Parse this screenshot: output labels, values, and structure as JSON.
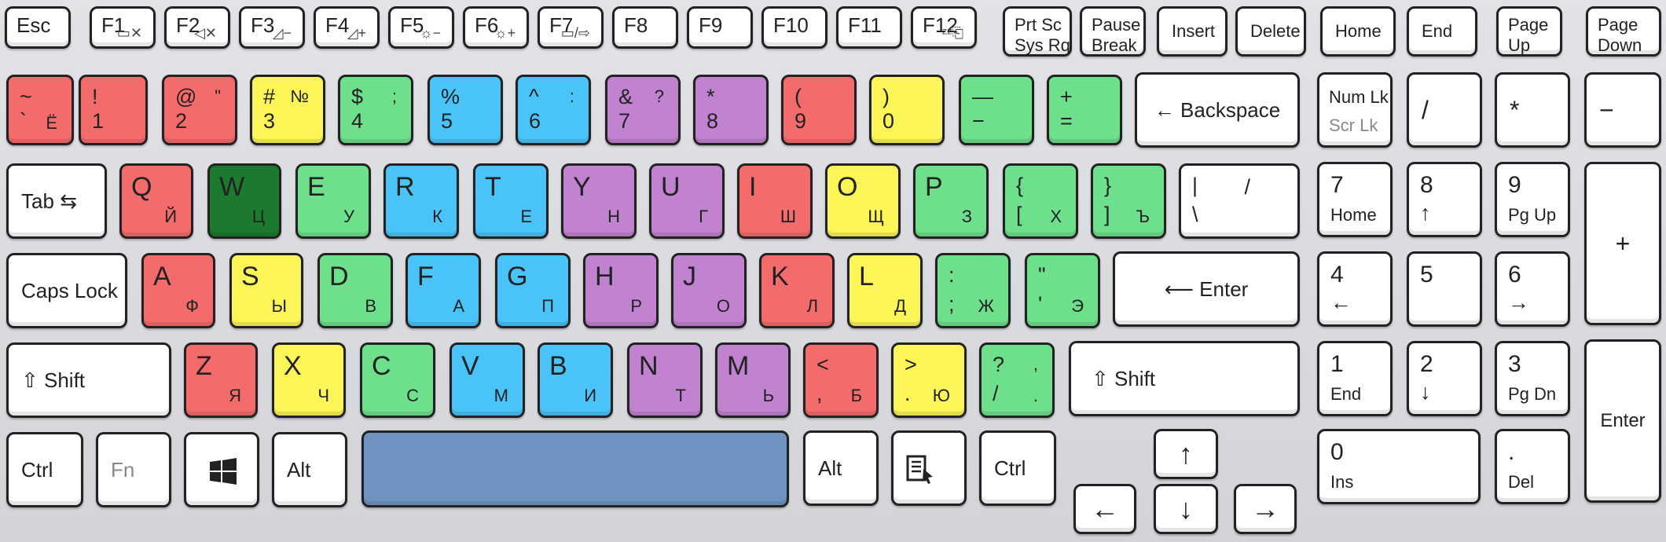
{
  "colors": {
    "red": "#f46b6b",
    "yellow": "#fbf558",
    "green": "#6ee08c",
    "blue": "#4ac3f8",
    "purple": "#c182d0",
    "dark_green": "#1b7a2e",
    "space": "#6f93c0",
    "key": "#ffffff",
    "frame": "#d9dade"
  },
  "function_row": {
    "esc": "Esc",
    "f1": "F1",
    "f2": "F2",
    "f3": "F3",
    "f4": "F4",
    "f5": "F5",
    "f6": "F6",
    "f7": "F7",
    "f8": "F8",
    "f9": "F9",
    "f10": "F10",
    "f11": "F11",
    "f12": "F12",
    "f3_icon": "◿−",
    "f4_icon": "◿+",
    "f5_icon": "☼−",
    "f6_icon": "☼+",
    "f2_icon": "🔇",
    "f7_icon": "▭/⇨",
    "prtsc_1": "Prt Sc",
    "prtsc_2": "Sys Rq",
    "pause_1": "Pause",
    "pause_2": "Break",
    "insert": "Insert",
    "delete": "Delete",
    "home": "Home",
    "end": "End",
    "pgup_1": "Page",
    "pgup_2": "Up",
    "pgdn_1": "Page",
    "pgdn_2": "Down"
  },
  "number_row": {
    "tilde": "~",
    "tilde_ru": "Ё",
    "tilde_b": "`",
    "k1_t": "!",
    "k1": "1",
    "k2_t": "@",
    "k2_tr": "\"",
    "k2": "2",
    "k3_t": "#",
    "k3_tr": "№",
    "k3": "3",
    "k4_t": "$",
    "k4_tr": ";",
    "k4": "4",
    "k5_t": "%",
    "k5": "5",
    "k6_t": "^",
    "k6_tr": ":",
    "k6": "6",
    "k7_t": "&",
    "k7_tr": "?",
    "k7": "7",
    "k8_t": "*",
    "k8": "8",
    "k9_t": "(",
    "k9": "9",
    "k0_t": ")",
    "k0": "0",
    "minus_t": "—",
    "minus": "−",
    "plus_t": "+",
    "equals": "=",
    "backspace": "← Backspace"
  },
  "top_row": {
    "tab": "Tab ⇆",
    "q": "Q",
    "q_ru": "Й",
    "w": "W",
    "w_ru": "Ц",
    "e": "E",
    "e_ru": "У",
    "r": "R",
    "r_ru": "К",
    "t": "T",
    "t_ru": "Е",
    "y": "Y",
    "y_ru": "Н",
    "u": "U",
    "u_ru": "Г",
    "i": "I",
    "i_ru": "Ш",
    "o": "O",
    "o_ru": "Щ",
    "p": "P",
    "p_ru": "З",
    "lbrace": "{",
    "lbracket": "[",
    "lb_ru": "Х",
    "rbrace": "}",
    "rbracket": "]",
    "rb_ru": "Ъ",
    "pipe": "|",
    "slash_ru": "/",
    "backslash": "\\"
  },
  "home_row": {
    "caps": "Caps Lock",
    "a": "A",
    "a_ru": "Ф",
    "s": "S",
    "s_ru": "Ы",
    "d": "D",
    "d_ru": "В",
    "f": "F",
    "f_ru": "А",
    "g": "G",
    "g_ru": "П",
    "h": "H",
    "h_ru": "Р",
    "j": "J",
    "j_ru": "О",
    "k": "K",
    "k_ru": "Л",
    "l": "L",
    "l_ru": "Д",
    "colon": ":",
    "semicolon": ";",
    "semi_ru": "Ж",
    "dquote": "\"",
    "squote": "'",
    "quote_ru": "Э",
    "enter": "⟵ Enter"
  },
  "bottom_row": {
    "shift_l": "⇧ Shift",
    "z": "Z",
    "z_ru": "Я",
    "x": "X",
    "x_ru": "Ч",
    "c": "C",
    "c_ru": "С",
    "v": "V",
    "v_ru": "М",
    "b": "B",
    "b_ru": "И",
    "n": "N",
    "n_ru": "Т",
    "m": "M",
    "m_ru": "Ь",
    "lt": "<",
    "comma": ",",
    "comma_ru": "Б",
    "gt": ">",
    "period": ".",
    "period_ru": "Ю",
    "question": "?",
    "slash": "/",
    "q_ru1": ",",
    "q_ru2": ".",
    "shift_r": "⇧ Shift"
  },
  "space_row": {
    "ctrl": "Ctrl",
    "fn": "Fn",
    "alt": "Alt",
    "alt_r": "Alt",
    "ctrl_r": "Ctrl",
    "up": "↑",
    "down": "↓",
    "left": "←",
    "right": "→"
  },
  "numpad": {
    "numlk": "Num Lk",
    "scrlk": "Scr Lk",
    "div": "/",
    "mul": "*",
    "minus": "−",
    "plus": "+",
    "enter": "Enter",
    "n7": "7",
    "n7_s": "Home",
    "n8": "8",
    "n8_s": "↑",
    "n9": "9",
    "n9_s": "Pg Up",
    "n4": "4",
    "n4_s": "←",
    "n5": "5",
    "n6": "6",
    "n6_s": "→",
    "n1": "1",
    "n1_s": "End",
    "n2": "2",
    "n2_s": "↓",
    "n3": "3",
    "n3_s": "Pg Dn",
    "n0": "0",
    "n0_s": "Ins",
    "dot": ".",
    "dot_s": "Del"
  }
}
